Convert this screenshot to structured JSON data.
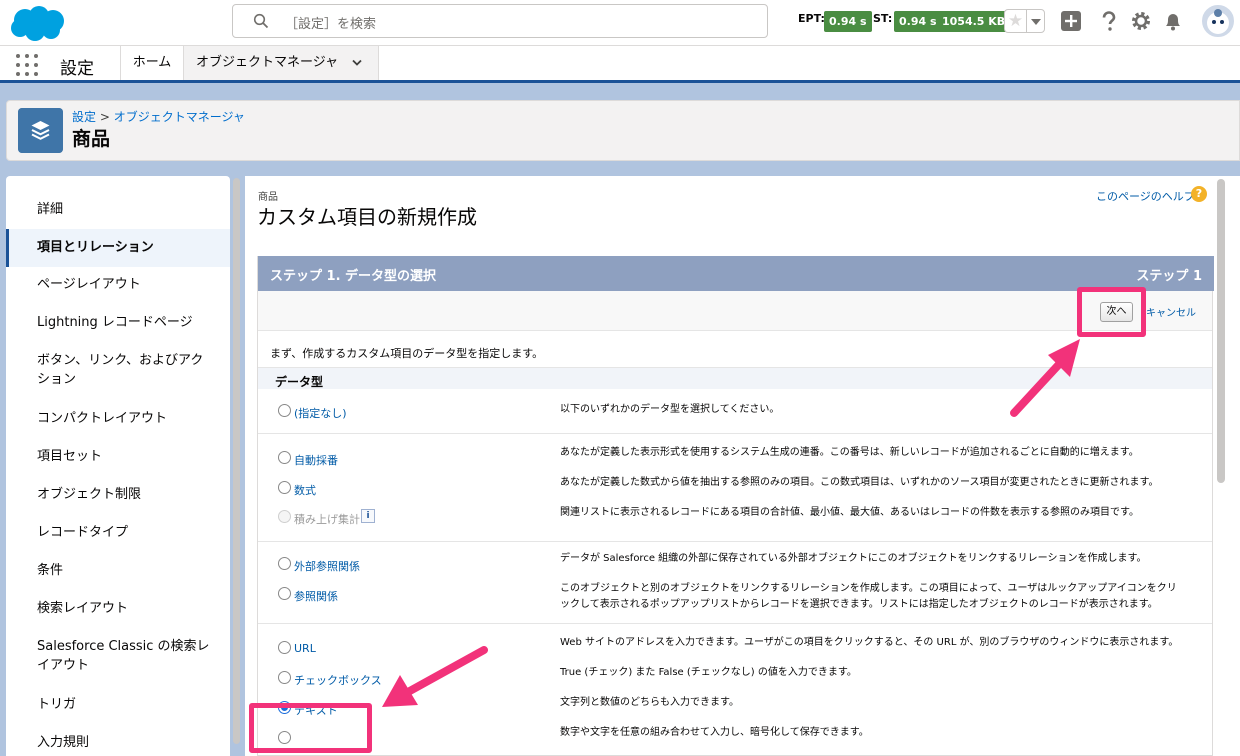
{
  "colors": {
    "brand": "#1b5297",
    "link": "#015ba7",
    "highlight": "#f2327a",
    "perf": "#4a8d42",
    "panel_header": "#8ea0c0"
  },
  "header": {
    "logo_icon": "salesforce-cloud",
    "search_placeholder": "［設定］を検索",
    "ept_label": "EPT:",
    "ept_value": "0.94 s",
    "st_label": "ST:",
    "st_value": "0.94 s",
    "size_value": "1054.5 KB",
    "icons": [
      "star-icon",
      "add-icon",
      "help-icon",
      "gear-icon",
      "bell-icon",
      "avatar"
    ]
  },
  "nav": {
    "app_name": "設定",
    "tabs": [
      {
        "label": "ホーム"
      },
      {
        "label": "オブジェクトマネージャ"
      }
    ]
  },
  "object_header": {
    "breadcrumb_root": "設定",
    "breadcrumb_sep": ">",
    "breadcrumb_child": "オブジェクトマネージャ",
    "title": "商品"
  },
  "sidebar": {
    "items": [
      {
        "label": "詳細"
      },
      {
        "label": "項目とリレーション",
        "active": true
      },
      {
        "label": "ページレイアウト"
      },
      {
        "label": "Lightning レコードページ"
      },
      {
        "label": "ボタン、リンク、およびアク"
      },
      {
        "label": "ション"
      },
      {
        "label": "コンパクトレイアウト"
      },
      {
        "label": "項目セット"
      },
      {
        "label": "オブジェクト制限"
      },
      {
        "label": "レコードタイプ"
      },
      {
        "label": "条件"
      },
      {
        "label": "検索レイアウト"
      },
      {
        "label": "Salesforce Classic の検索レ"
      },
      {
        "label": "イアウト"
      },
      {
        "label": "トリガ"
      },
      {
        "label": "入力規則"
      }
    ]
  },
  "main": {
    "eyebrow": "商品",
    "title": "カスタム項目の新規作成",
    "help_link": "このページのヘルプ",
    "help_icon": "?",
    "step_title": "ステップ 1. データ型の選択",
    "step_indicator": "ステップ 1",
    "next_button": "次へ",
    "cancel_link": "キャンセル",
    "instruction": "まず、作成するカスタム項目のデータ型を指定します。",
    "section_title": "データ型",
    "info_icon": "i",
    "options": [
      {
        "label": "(指定なし)",
        "desc": "以下のいずれかのデータ型を選択してください。"
      },
      {
        "label": "自動採番",
        "desc": "あなたが定義した表示形式を使用するシステム生成の連番。この番号は、新しいレコードが追加されるごとに自動的に増えます。"
      },
      {
        "label": "数式",
        "desc": "あなたが定義した数式から値を抽出する参照のみの項目。この数式項目は、いずれかのソース項目が変更されたときに更新されます。"
      },
      {
        "label": "積み上げ集計",
        "desc": "関連リストに表示されるレコードにある項目の合計値、最小値、最大値、あるいはレコードの件数を表示する参照のみ項目です。",
        "disabled": true
      },
      {
        "label": "外部参照関係",
        "desc": "データが Salesforce 組織の外部に保存されている外部オブジェクトにこのオブジェクトをリンクするリレーションを作成します。"
      },
      {
        "label": "参照関係",
        "desc": "このオブジェクトと別のオブジェクトをリンクするリレーションを作成します。この項目によって、ユーザはルックアップアイコンをクリックして表示されるポップアップリストからレコードを選択できます。リストには指定したオブジェクトのレコードが表示されます。"
      },
      {
        "label": "URL",
        "desc": "Web サイトのアドレスを入力できます。ユーザがこの項目をクリックすると、その URL が、別のブラウザのウィンドウに表示されます。"
      },
      {
        "label": "チェックボックス",
        "desc": "True (チェック) また False (チェックなし) の値を入力できます。"
      },
      {
        "label": "テキスト",
        "desc": "文字列と数値のどちらも入力できます。",
        "selected": true
      },
      {
        "label": "",
        "desc": "数字や文字を任意の組み合わせて入力し、暗号化して保存できます。"
      }
    ]
  }
}
